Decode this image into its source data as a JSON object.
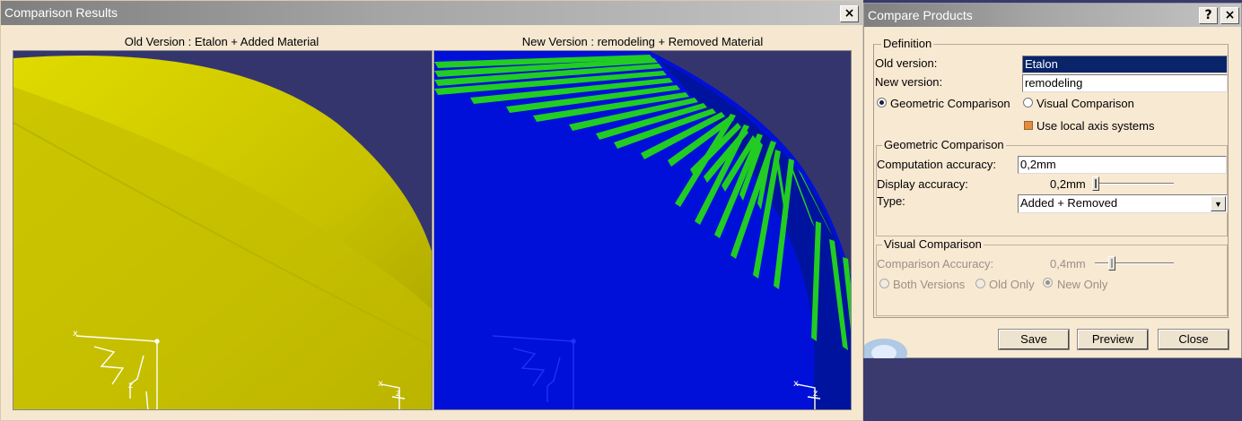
{
  "results_window": {
    "title": "Comparison Results",
    "close_glyph": "×",
    "old_view_caption": "Old Version : Etalon + Added Material",
    "new_view_caption": "New Version : remodeling + Removed Material",
    "axis_labels": {
      "x": "x",
      "y": "y",
      "z": "z"
    }
  },
  "dialog": {
    "title": "Compare Products",
    "help_glyph": "?",
    "close_glyph": "×",
    "definition": {
      "group_title": "Definition",
      "old_version_label": "Old version:",
      "old_version_value": "Etalon",
      "new_version_label": "New version:",
      "new_version_value": "remodeling",
      "geometric_radio_label": "Geometric Comparison",
      "geometric_radio_selected": true,
      "visual_radio_label": "Visual Comparison",
      "visual_radio_selected": false,
      "local_axis_label": "Use local axis systems",
      "local_axis_checked": true
    },
    "geometric": {
      "group_title": "Geometric Comparison",
      "computation_accuracy_label": "Computation accuracy:",
      "computation_accuracy_value": "0,2mm",
      "display_accuracy_label": "Display accuracy:",
      "display_accuracy_value": "0,2mm",
      "type_label": "Type:",
      "type_value": "Added + Removed"
    },
    "visual": {
      "group_title": "Visual Comparison",
      "comparison_accuracy_label": "Comparison Accuracy:",
      "comparison_accuracy_value": "0,4mm",
      "both_versions_label": "Both Versions",
      "old_only_label": "Old Only",
      "new_only_label": "New Only",
      "selected": "new_only"
    },
    "buttons": {
      "save": "Save",
      "preview": "Preview",
      "close": "Close"
    }
  },
  "colors": {
    "old_surface": "#c9c300",
    "new_surface": "#0010d8",
    "removed_material": "#22cc22",
    "background": "#35356e"
  }
}
